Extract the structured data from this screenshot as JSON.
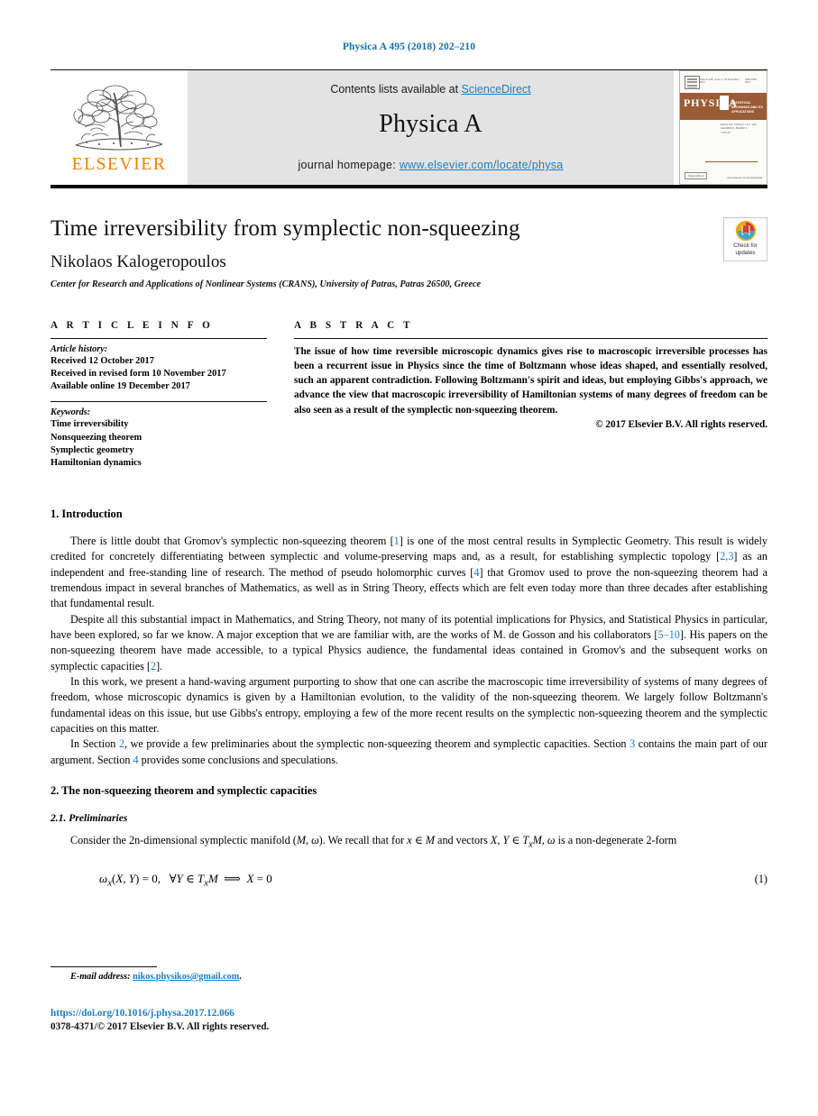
{
  "running_head": "Physica A 495 (2018) 202–210",
  "journal_header": {
    "publisher_logo_text": "ELSEVIER",
    "contents_prefix": "Contents lists available at ",
    "contents_link": "ScienceDirect",
    "journal_title": "Physica A",
    "homepage_prefix": "journal homepage: ",
    "homepage_link": "www.elsevier.com/locate/physa",
    "cover": {
      "brand": "PHYSICA",
      "subtitle": "STATISTICAL MECHANICS AND ITS APPLICATIONS",
      "issue_line": "Volume 495, Issue 1, 15 November 2017",
      "issn_line": "ISSN 0378-4371",
      "editors": "Editors\nH.E. STANLEY\nJ.M.J. VAN LEEUWEN\nK. BINDER\nC. TSALLIS",
      "badge": "ScienceDirect",
      "url": "www.elsevier.com/locate/physa"
    },
    "band_color": "#e3e3e3",
    "link_color": "#1b7fc4",
    "elsevier_orange": "#F08000"
  },
  "article": {
    "title": "Time irreversibility from symplectic non-squeezing",
    "author": "Nikolaos Kalogeropoulos",
    "affiliation": "Center for Research and Applications of Nonlinear Systems (CRANS), University of Patras, Patras 26500, Greece",
    "crossmark": {
      "line1": "Check for",
      "line2": "updates"
    }
  },
  "article_info": {
    "heading": "A R T I C L E   I N F O",
    "history_label": "Article history:",
    "history": [
      "Received 12 October 2017",
      "Received in revised form 10 November 2017",
      "Available online 19 December 2017"
    ],
    "keywords_label": "Keywords:",
    "keywords": [
      "Time irreversibility",
      "Nonsqueezing theorem",
      "Symplectic geometry",
      "Hamiltonian dynamics"
    ]
  },
  "abstract": {
    "heading": "A B S T R A C T",
    "text": "The issue of how time reversible microscopic dynamics gives rise to macroscopic irreversible processes has been a recurrent issue in Physics since the time of Boltzmann whose ideas shaped, and essentially resolved, such an apparent contradiction. Following Boltzmann's spirit and ideas, but employing Gibbs's approach, we advance the view that macroscopic irreversibility of Hamiltonian systems of many degrees of freedom can be also seen as a result of the symplectic non-squeezing theorem.",
    "copyright": "© 2017 Elsevier B.V. All rights reserved."
  },
  "sections": {
    "intro_heading": "1.  Introduction",
    "intro_paragraphs": [
      "There is little doubt that Gromov's symplectic non-squeezing theorem [1] is one of the most central results in Symplectic Geometry. This result is widely credited for concretely differentiating between symplectic and volume-preserving maps and, as a result, for establishing symplectic topology [2,3] as an independent and free-standing line of research. The method of pseudo holomorphic curves [4] that Gromov used to prove the non-squeezing theorem had a tremendous impact in several branches of Mathematics, as well as in String Theory, effects which are felt even today more than three decades after establishing that fundamental result.",
      "Despite all this substantial impact in Mathematics, and String Theory, not many of its potential implications for Physics, and Statistical Physics in particular, have been explored, so far we know. A major exception that we are familiar with, are the works of M. de Gosson and his collaborators [5–10]. His papers on the non-squeezing theorem have made accessible, to a typical Physics audience, the fundamental ideas contained in Gromov's and the subsequent works on symplectic capacities [2].",
      "In this work, we present a hand-waving argument purporting to show that one can ascribe the macroscopic time irreversibility of systems of many degrees of freedom, whose microscopic dynamics is given by a Hamiltonian evolution, to the validity of the non-squeezing theorem. We largely follow Boltzmann's fundamental ideas on this issue, but use Gibbs's entropy, employing a few of the more recent results on the symplectic non-squeezing theorem and the symplectic capacities on this matter.",
      "In Section 2, we provide a few preliminaries about the symplectic non-squeezing theorem and symplectic capacities. Section 3 contains the main part of our argument. Section 4 provides some conclusions and speculations."
    ],
    "sec2_heading": "2.  The non-squeezing theorem and symplectic capacities",
    "sec2_sub_heading": "2.1.  Preliminaries",
    "sec2_paragraph": "Consider the 2n-dimensional symplectic manifold (M, ω). We recall that for x ∈ M and vectors X, Y ∈ TxM, ω is a non-degenerate 2-form",
    "equation": "ωx(X, Y) = 0,   ∀Y ∈ TxM  ⟹  X = 0",
    "equation_number": "(1)"
  },
  "footer": {
    "email_label": "E-mail address:",
    "email": "nikos.physikos@gmail.com",
    "email_suffix": ".",
    "doi": "https://doi.org/10.1016/j.physa.2017.12.066",
    "issn_line": "0378-4371/© 2017 Elsevier B.V. All rights reserved."
  }
}
